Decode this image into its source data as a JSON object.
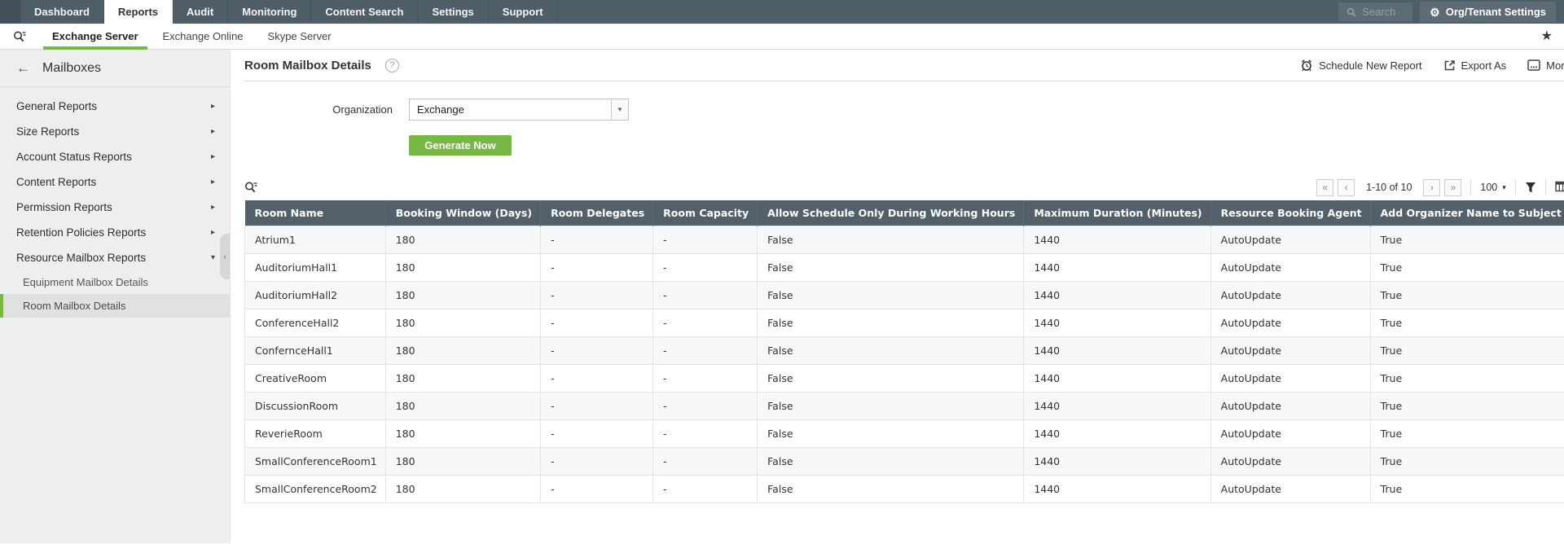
{
  "topnav": {
    "items": [
      {
        "label": "Dashboard"
      },
      {
        "label": "Reports",
        "active": true
      },
      {
        "label": "Audit"
      },
      {
        "label": "Monitoring"
      },
      {
        "label": "Content Search"
      },
      {
        "label": "Settings"
      },
      {
        "label": "Support"
      }
    ],
    "search_placeholder": "Search",
    "org_tenant_label": "Org/Tenant Settings"
  },
  "tabbar": {
    "tabs": [
      {
        "label": "Exchange Server",
        "active": true
      },
      {
        "label": "Exchange Online"
      },
      {
        "label": "Skype Server"
      }
    ]
  },
  "sidebar": {
    "title": "Mailboxes",
    "items": [
      {
        "label": "General Reports",
        "chevron": "▸"
      },
      {
        "label": "Size Reports",
        "chevron": "▸"
      },
      {
        "label": "Account Status Reports",
        "chevron": "▸"
      },
      {
        "label": "Content Reports",
        "chevron": "▸"
      },
      {
        "label": "Permission Reports",
        "chevron": "▸"
      },
      {
        "label": "Retention Policies Reports",
        "chevron": "▸"
      },
      {
        "label": "Resource Mailbox Reports",
        "chevron": "▾",
        "expanded": true
      }
    ],
    "subitems": [
      {
        "label": "Equipment Mailbox Details"
      },
      {
        "label": "Room Mailbox Details",
        "selected": true
      }
    ]
  },
  "page": {
    "title": "Room Mailbox Details",
    "actions": {
      "schedule": "Schedule New Report",
      "export": "Export As",
      "more": "More"
    }
  },
  "form": {
    "organization_label": "Organization",
    "organization_value": "Exchange",
    "generate_label": "Generate Now"
  },
  "toolbar": {
    "pagination_text": "1-10 of 10",
    "page_size": "100"
  },
  "table": {
    "columns": [
      "Room Name",
      "Booking Window (Days)",
      "Room Delegates",
      "Room Capacity",
      "Allow Schedule Only During Working Hours",
      "Maximum Duration (Minutes)",
      "Resource Booking Agent",
      "Add Organizer Name to Subject"
    ],
    "rows": [
      [
        "Atrium1",
        "180",
        "-",
        "-",
        "False",
        "1440",
        "AutoUpdate",
        "True"
      ],
      [
        "AuditoriumHall1",
        "180",
        "-",
        "-",
        "False",
        "1440",
        "AutoUpdate",
        "True"
      ],
      [
        "AuditoriumHall2",
        "180",
        "-",
        "-",
        "False",
        "1440",
        "AutoUpdate",
        "True"
      ],
      [
        "ConferenceHall2",
        "180",
        "-",
        "-",
        "False",
        "1440",
        "AutoUpdate",
        "True"
      ],
      [
        "ConfernceHall1",
        "180",
        "-",
        "-",
        "False",
        "1440",
        "AutoUpdate",
        "True"
      ],
      [
        "CreativeRoom",
        "180",
        "-",
        "-",
        "False",
        "1440",
        "AutoUpdate",
        "True"
      ],
      [
        "DiscussionRoom",
        "180",
        "-",
        "-",
        "False",
        "1440",
        "AutoUpdate",
        "True"
      ],
      [
        "ReverieRoom",
        "180",
        "-",
        "-",
        "False",
        "1440",
        "AutoUpdate",
        "True"
      ],
      [
        "SmallConferenceRoom1",
        "180",
        "-",
        "-",
        "False",
        "1440",
        "AutoUpdate",
        "True"
      ],
      [
        "SmallConferenceRoom2",
        "180",
        "-",
        "-",
        "False",
        "1440",
        "AutoUpdate",
        "True"
      ]
    ]
  },
  "icons": {
    "gear": "⚙",
    "star": "★",
    "back_arrow": "←",
    "help": "?",
    "first_page": "«",
    "prev_page": "‹",
    "next_page": "›",
    "last_page": "»",
    "caret_down": "▾",
    "select_arrow": "▼",
    "collapse_left": "‹"
  },
  "colors": {
    "accent_green": "#77b843",
    "topnav_bg": "#4f5d66",
    "table_header_bg": "#546069"
  }
}
